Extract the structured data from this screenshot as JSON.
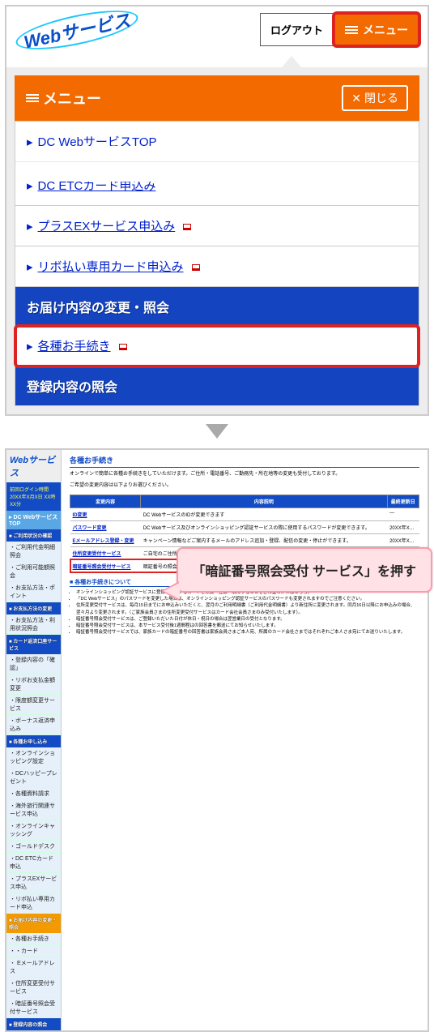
{
  "screen1": {
    "logo": "Webサービス",
    "logout": "ログアウト",
    "menu_btn": "メニュー",
    "menu_title": "メニュー",
    "close": "閉じる",
    "items": [
      "DC WebサービスTOP",
      "DC ETCカード申込み",
      "プラスEXサービス申込み",
      "リボ払い専用カード申込み"
    ],
    "section1": "お届け内容の変更・照会",
    "proc_item": "各種お手続き",
    "section2": "登録内容の照会"
  },
  "screen2": {
    "logo": "Webサービス",
    "login_box": "前回ログイン時間\n20XX年X月X日\nXX時XX分",
    "side_top": "DC WebサービスTOP",
    "side_groups": [
      {
        "title": "ご利用状況の確認",
        "items": [
          "ご利用代金明細照会",
          "ご利用可能額照会",
          "お支払方法・ポイント"
        ]
      },
      {
        "title": "お支払方法の変更",
        "items": [
          "お支払方法・利用状況照会"
        ]
      },
      {
        "title": "カード返済口座サービス",
        "items": [
          "登録内容の「確認」",
          "リボお支払金額変更",
          "限度額変更サービス",
          "ボーナス返済申込み"
        ]
      },
      {
        "title": "各種お申し込み",
        "items": [
          "オンラインショッピング設定",
          "DCハッピープレゼント",
          "各種資料請求",
          "海外旅行関連サービス申込",
          "オンラインキャッシング",
          "ゴールドデスク",
          "DC ETCカード申込",
          "プラスEXサービス申込",
          "リボ払い専用カード申込"
        ]
      },
      {
        "title": "お届け内容の変更・照会",
        "orange": true,
        "items": [
          "各種お手続き",
          "・カード",
          " Eメールアドレス",
          "住所変更受付サービス",
          "暗証番号照会受付サービス"
        ]
      },
      {
        "title": "登録内容の照会",
        "items": []
      }
    ],
    "page_title": "各種お手続き",
    "intro1": "オンラインで簡単に各種お手続きをしていただけます。ご住所・電話番号、ご勤務先・所在地等の変更も受付しております。",
    "intro2": "ご希望の変更内容は以下よりお選びください。",
    "th": [
      "変更内容",
      "内容説明",
      "最終更新日"
    ],
    "rows": [
      {
        "name": "ID変更",
        "desc": "DC WebサービスのIDが変更できます",
        "date": "—"
      },
      {
        "name": "パスワード変更",
        "desc": "DC Webサービス及びオンラインショッピング認証サービスの際に使用するパスワードが変更できます。",
        "date": "20XX年X…"
      },
      {
        "name": "Eメールアドレス登録・変更",
        "desc": "キャンペーン情報などご案内するメールのアドレス追加・登録、配信の変更・停止ができます。",
        "date": "20XX年X…"
      },
      {
        "name": "住所変更受付サービス",
        "desc": "ご自宅のご住所・電話番号、勤務先のご住所・電話番号の変更のお申込みができます。",
        "date": "—"
      },
      {
        "name": "暗証番号照会受付サービス",
        "desc": "暗証番号の照会を受付しています（郵送にてお知らせいたします）。",
        "date": "—"
      }
    ],
    "sub_title": "各種お手続きについて",
    "notes": [
      "オンラインショッピング認証サービスに登録されているカードを照会・登録・解除することをご希望のかたはこちら。",
      "「DC Webサービス」のパスワードを変更した場合は、オンラインショッピング認証サービスのパスワードも変更されますのでご注意ください。",
      "住所変更受付サービスは、毎月15日までにお申込みいただくと、翌月のご利用明細書（ご利用代金明細書）より新住所に変更されます。同月16日以降にお申込みの場合、翌々月より変更されます。（ご家族会員さまの住所変更受付サービスはカード会社会員さまのみ受付いたします）。",
      "暗証番号照会受付サービスは、ご登録いただいた日付が休日・祝日の場合は翌営業日の受付となります。",
      "暗証番号照会受付サービスは、本サービス受付後1週間程はの回答書を郵送にてお知らせいたします。",
      "暗証番号照会受付サービスでは、家族カードの暗証番号の回答書は家族会員さまご本人宛、所属のカード会社さまではそれぞれご本人さま宛にてお送りいたします。"
    ]
  },
  "callout": "「暗証番号照会受付\nサービス」を押す"
}
